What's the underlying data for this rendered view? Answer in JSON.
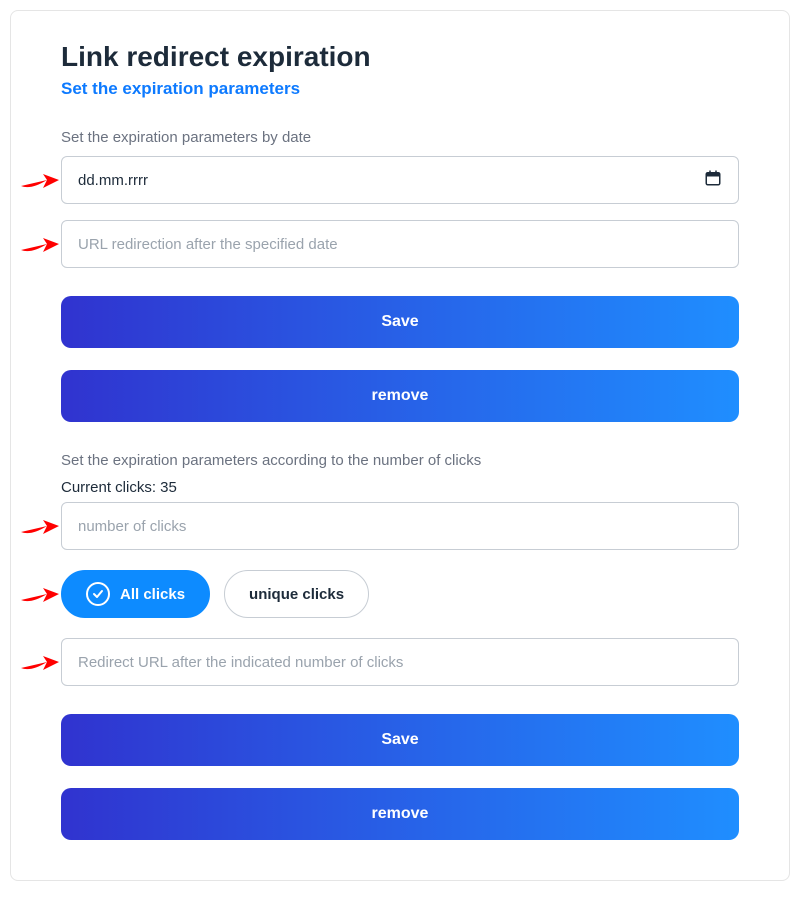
{
  "title": "Link redirect expiration",
  "subtitle": "Set the expiration parameters",
  "date_section": {
    "label": "Set the expiration parameters by date",
    "date_placeholder": "dd.mm.rrrr",
    "url_placeholder": "URL redirection after the specified date",
    "save_label": "Save",
    "remove_label": "remove"
  },
  "clicks_section": {
    "label": "Set the expiration parameters according to the number of clicks",
    "current_clicks_label": "Current clicks: 35",
    "current_clicks_value": 35,
    "number_placeholder": "number of clicks",
    "option_all": "All clicks",
    "option_unique": "unique clicks",
    "selected_option": "all",
    "redirect_placeholder": "Redirect URL after the indicated number of clicks",
    "save_label": "Save",
    "remove_label": "remove"
  },
  "colors": {
    "accent": "#0d7aff",
    "gradient_from": "#3033cf",
    "gradient_to": "#1f8eff",
    "arrow": "#ff0000"
  }
}
